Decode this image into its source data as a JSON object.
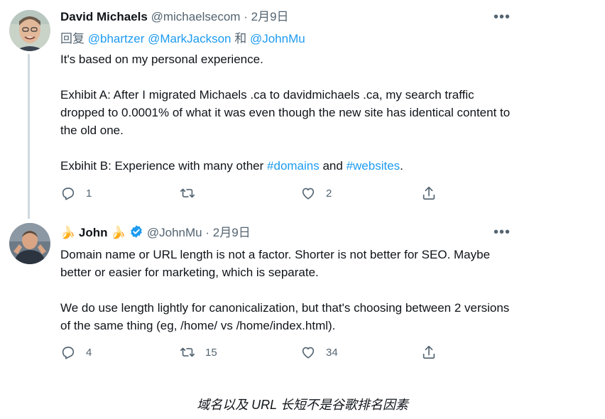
{
  "tweet1": {
    "name": "David Michaels",
    "handle": "@michaelsecom",
    "sep": "·",
    "date": "2月9日",
    "reply_prefix": "回复",
    "reply_to": [
      "@bhartzer",
      "@MarkJackson"
    ],
    "reply_and": "和",
    "reply_last": "@JohnMu",
    "line1": "It's based on my personal experience.",
    "para2": "Exhibit A: After I migrated Michaels .ca to davidmichaels .ca, my search traffic dropped to 0.0001% of what it was even though the new site has identical content to the old one.",
    "para3_a": "Exbihit B: Experience with many other ",
    "hashtag1": "#domains",
    "para3_b": " and ",
    "hashtag2": "#websites",
    "para3_c": ".",
    "replies": "1",
    "retweets": "",
    "likes": "2"
  },
  "tweet2": {
    "name": "John",
    "emoji_left": "🍌",
    "emoji_right": "🍌",
    "handle": "@JohnMu",
    "sep": "·",
    "date": "2月9日",
    "para1": "Domain name or URL length is not a factor. Shorter is not better for SEO. Maybe better or easier for marketing, which is separate.",
    "para2": "We do use length lightly for canonicalization, but that's choosing between 2 versions of the same thing (eg, /home/ vs /home/index.html).",
    "replies": "4",
    "retweets": "15",
    "likes": "34"
  },
  "more_label": "•••",
  "caption": "域名以及 URL 长短不是谷歌排名因素",
  "colors": {
    "link": "#1d9bf0",
    "muted": "#536471",
    "verified": "#1d9bf0",
    "thread_line": "#cfd9de"
  }
}
